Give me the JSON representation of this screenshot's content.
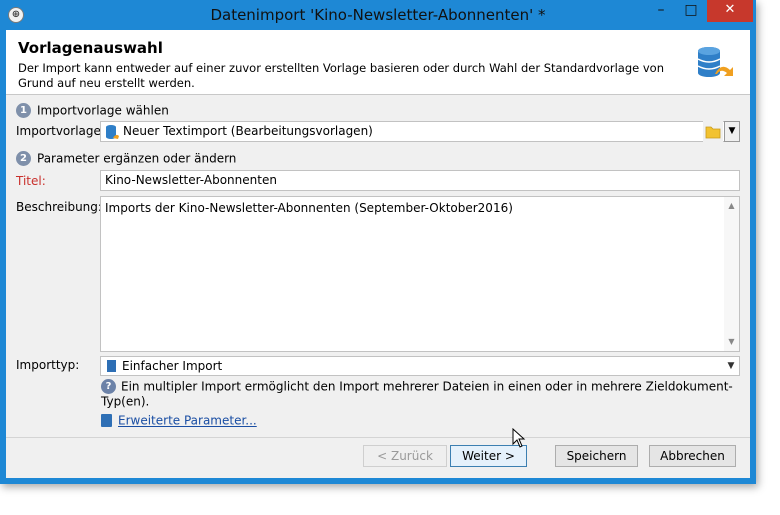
{
  "window": {
    "title": "Datenimport 'Kino-Newsletter-Abonnenten' *",
    "controls": {
      "minimize": "–",
      "maximize": "□",
      "close": "✕"
    },
    "app_icon": "⊕"
  },
  "header": {
    "title": "Vorlagenauswahl",
    "description": "Der Import kann entweder auf einer zuvor erstellten Vorlage basieren oder durch Wahl der Standardvorlage von Grund auf neu erstellt werden.",
    "icon": "database-import-icon"
  },
  "step1": {
    "number": "1",
    "label": "Importvorlage wählen"
  },
  "importvorlage": {
    "label": "Importvorlage:",
    "value": "Neuer Textimport (Bearbeitungsvorlagen)",
    "icon": "database-icon"
  },
  "step2": {
    "number": "2",
    "label": "Parameter ergänzen oder ändern"
  },
  "titel": {
    "label": "Titel:",
    "value": "Kino-Newsletter-Abonnenten",
    "label_color": "#c9302c"
  },
  "beschreibung": {
    "label": "Beschreibung:",
    "value": "Imports der Kino-Newsletter-Abonnenten (September-Oktober2016)"
  },
  "importtyp": {
    "label": "Importtyp:",
    "value": "Einfacher Import",
    "icon": "document-icon"
  },
  "hint": {
    "icon": "help-icon",
    "text": "Ein multipler Import ermöglicht den Import mehrerer Dateien in einen oder in mehrere Zieldokument-Typ(en)."
  },
  "advanced": {
    "icon": "clipboard-icon",
    "link": "Erweiterte Parameter..."
  },
  "buttons": {
    "back": "< Zurück",
    "next": "Weiter >",
    "save": "Speichern",
    "cancel": "Abbrechen"
  },
  "colors": {
    "titlebar": "#1e88d5",
    "close": "#c7382c",
    "accent_link": "#1a4ea3"
  }
}
